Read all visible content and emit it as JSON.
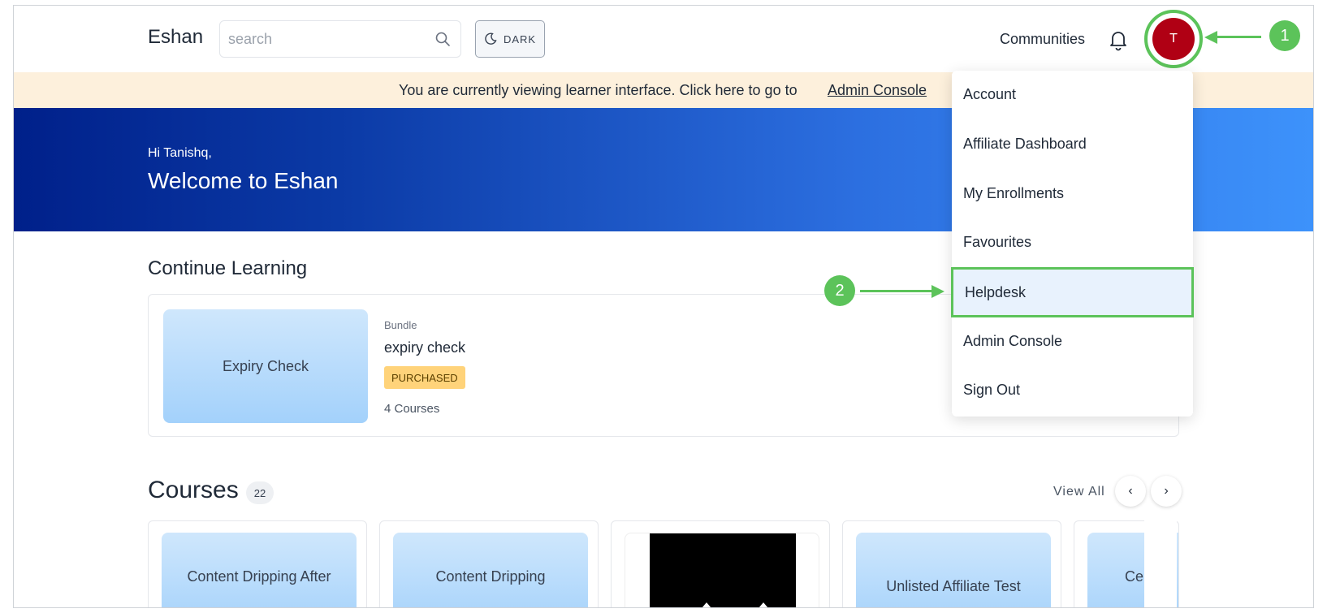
{
  "header": {
    "brand": "Eshan",
    "search_placeholder": "search",
    "dark_label": "DARK",
    "communities_label": "Communities",
    "avatar_initial": "T"
  },
  "notice": {
    "text": "You are currently viewing learner interface. Click here to go to",
    "link": "Admin Console"
  },
  "hero": {
    "greeting": "Hi Tanishq,",
    "title": "Welcome to Eshan"
  },
  "continue_learning": {
    "title": "Continue Learning",
    "card": {
      "thumb_label": "Expiry Check",
      "type": "Bundle",
      "name": "expiry check",
      "badge": "PURCHASED",
      "count": "4 Courses"
    }
  },
  "courses": {
    "title": "Courses",
    "count": "22",
    "view_all": "View All",
    "prev": "‹",
    "next": "›",
    "items": [
      {
        "label": "Content Dripping After"
      },
      {
        "label": "Content Dripping"
      },
      {
        "label": ""
      },
      {
        "label": "Unlisted Affiliate Test"
      },
      {
        "label": "Cer"
      }
    ]
  },
  "dropdown": {
    "items": [
      {
        "label": "Account"
      },
      {
        "label": "Affiliate Dashboard"
      },
      {
        "label": "My Enrollments"
      },
      {
        "label": "Favourites"
      },
      {
        "label": "Helpdesk"
      },
      {
        "label": "Admin Console"
      },
      {
        "label": "Sign Out"
      }
    ]
  },
  "annotations": {
    "step1": "1",
    "step2": "2",
    "color": "#5cc35a"
  }
}
